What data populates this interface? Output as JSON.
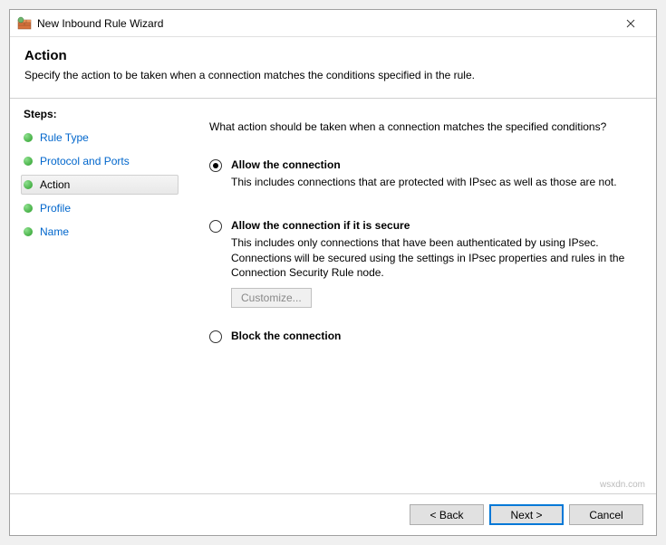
{
  "window": {
    "title": "New Inbound Rule Wizard",
    "close": "×"
  },
  "header": {
    "title": "Action",
    "description": "Specify the action to be taken when a connection matches the conditions specified in the rule."
  },
  "sidebar": {
    "heading": "Steps:",
    "items": [
      {
        "label": "Rule Type",
        "current": false
      },
      {
        "label": "Protocol and Ports",
        "current": false
      },
      {
        "label": "Action",
        "current": true
      },
      {
        "label": "Profile",
        "current": false
      },
      {
        "label": "Name",
        "current": false
      }
    ]
  },
  "main": {
    "prompt": "What action should be taken when a connection matches the specified conditions?",
    "options": [
      {
        "title": "Allow the connection",
        "description": "This includes connections that are protected with IPsec as well as those are not.",
        "selected": true
      },
      {
        "title": "Allow the connection if it is secure",
        "description": "This includes only connections that have been authenticated by using IPsec. Connections will be secured using the settings in IPsec properties and rules in the Connection Security Rule node.",
        "selected": false,
        "customize_label": "Customize..."
      },
      {
        "title": "Block the connection",
        "description": "",
        "selected": false
      }
    ]
  },
  "footer": {
    "back": "< Back",
    "next": "Next >",
    "cancel": "Cancel"
  },
  "watermark": "wsxdn.com"
}
